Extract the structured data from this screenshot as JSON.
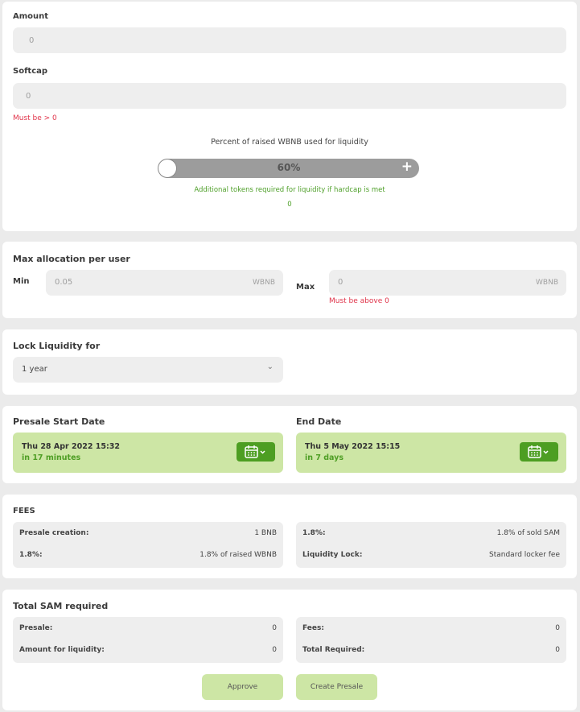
{
  "amount": {
    "label": "Amount",
    "value": "0"
  },
  "softcap": {
    "label": "Softcap",
    "value": "0",
    "error": "Must be > 0"
  },
  "liquidity": {
    "title": "Percent of raised WBNB used for liquidity",
    "percent": "60%",
    "plus": "+",
    "note": "Additional tokens required for liquidity if hardcap is met",
    "tokens": "0"
  },
  "allocation": {
    "title": "Max allocation per user",
    "min_label": "Min",
    "min_value": "0.05",
    "min_unit": "WBNB",
    "max_label": "Max",
    "max_value": "0",
    "max_unit": "WBNB",
    "max_error": "Must be above 0"
  },
  "lock": {
    "title": "Lock Liquidity for",
    "selected": "1 year"
  },
  "dates": {
    "start_title": "Presale Start Date",
    "start_date": "Thu 28 Apr 2022 15:32",
    "start_rel": "in 17 minutes",
    "end_title": "End Date",
    "end_date": "Thu 5 May 2022 15:15",
    "end_rel": "in 7 days"
  },
  "fees": {
    "title": "FEES",
    "left": [
      {
        "label": "Presale creation:",
        "value": "1 BNB"
      },
      {
        "label": "1.8%:",
        "value": "1.8% of raised WBNB"
      }
    ],
    "right": [
      {
        "label": "1.8%:",
        "value": "1.8% of sold SAM"
      },
      {
        "label": "Liquidity Lock:",
        "value": "Standard locker fee"
      }
    ]
  },
  "total": {
    "title": "Total SAM required",
    "left": [
      {
        "label": "Presale:",
        "value": "0"
      },
      {
        "label": "Amount for liquidity:",
        "value": "0"
      }
    ],
    "right": [
      {
        "label": "Fees:",
        "value": "0"
      },
      {
        "label": "Total Required:",
        "value": "0"
      }
    ]
  },
  "actions": {
    "approve": "Approve",
    "create": "Create Presale"
  },
  "colors": {
    "accent": "#4d9e22",
    "accent_light": "#cde6a5",
    "error": "#e0344a"
  }
}
